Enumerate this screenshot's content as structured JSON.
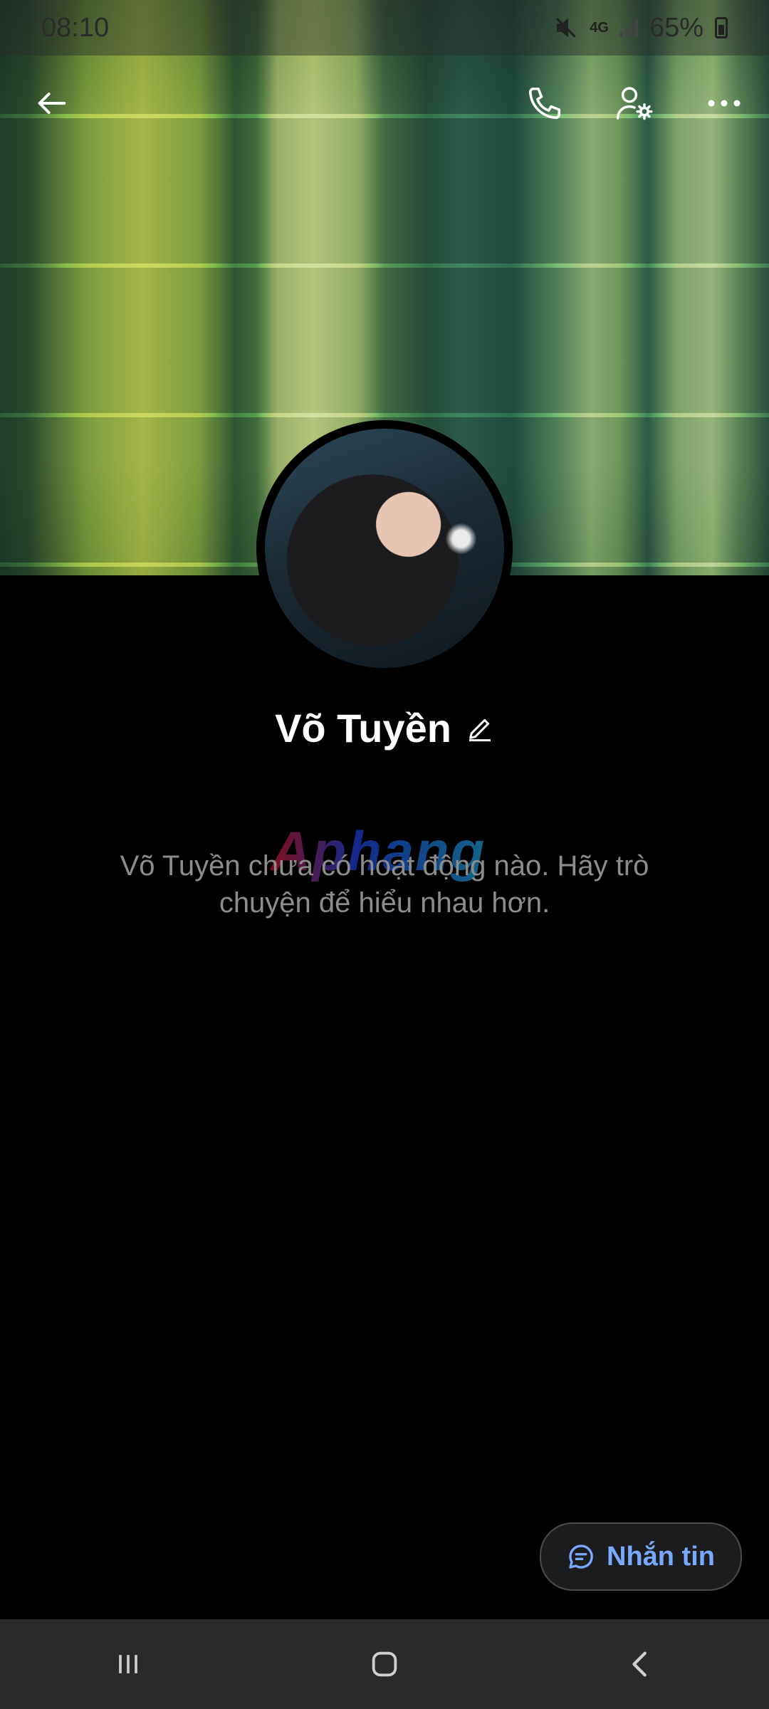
{
  "status_bar": {
    "time": "08:10",
    "network": "4G",
    "battery": "65%"
  },
  "profile": {
    "name": "Võ Tuyền",
    "empty_message": "Võ Tuyền chưa có hoạt động nào. Hãy trò chuyện để hiểu nhau hơn.",
    "watermark": "Aphang"
  },
  "actions": {
    "message_label": "Nhắn tin"
  },
  "colors": {
    "accent": "#78a9ff",
    "background": "#000000",
    "navbar": "#2a2a2a"
  }
}
